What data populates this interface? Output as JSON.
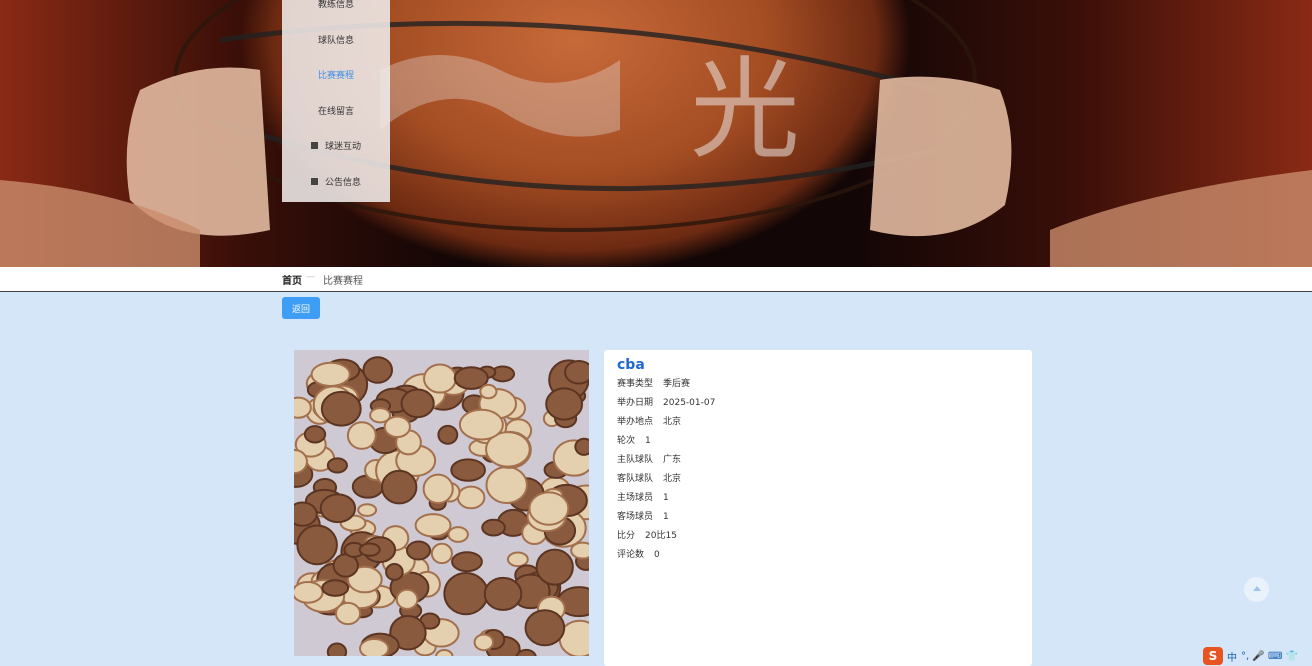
{
  "nav": {
    "items": [
      {
        "label": "教练信息",
        "icon": "",
        "active": false
      },
      {
        "label": "球队信息",
        "icon": "",
        "active": false
      },
      {
        "label": "比赛赛程",
        "icon": "",
        "active": true
      },
      {
        "label": "在线留言",
        "icon": "",
        "active": false
      },
      {
        "label": "球迷互动",
        "icon": "square-icon",
        "active": false
      },
      {
        "label": "公告信息",
        "icon": "square-icon",
        "active": false
      }
    ]
  },
  "banner": {
    "watermark": "光"
  },
  "breadcrumb": {
    "home": "首页",
    "separator": "—",
    "current": "比赛赛程"
  },
  "actions": {
    "back_label": "返回"
  },
  "detail": {
    "title": "cba",
    "fields": [
      {
        "label": "赛事类型",
        "value": "季后赛"
      },
      {
        "label": "举办日期",
        "value": "2025-01-07"
      },
      {
        "label": "举办地点",
        "value": "北京"
      },
      {
        "label": "轮次",
        "value": "1"
      },
      {
        "label": "主队球队",
        "value": "广东"
      },
      {
        "label": "客队球队",
        "value": "北京"
      },
      {
        "label": "主场球员",
        "value": "1"
      },
      {
        "label": "客场球员",
        "value": "1"
      },
      {
        "label": "比分",
        "value": "20比15"
      },
      {
        "label": "评论数",
        "value": "0"
      }
    ]
  },
  "ime": {
    "logo": "S",
    "lang": "中",
    "extra": "°, 🎤 ⌨ 👕"
  },
  "colors": {
    "accent": "#3e9ef5",
    "title": "#1f6ad0",
    "page_bg": "#d4e6f8",
    "nav_active": "#3d8fe8"
  }
}
